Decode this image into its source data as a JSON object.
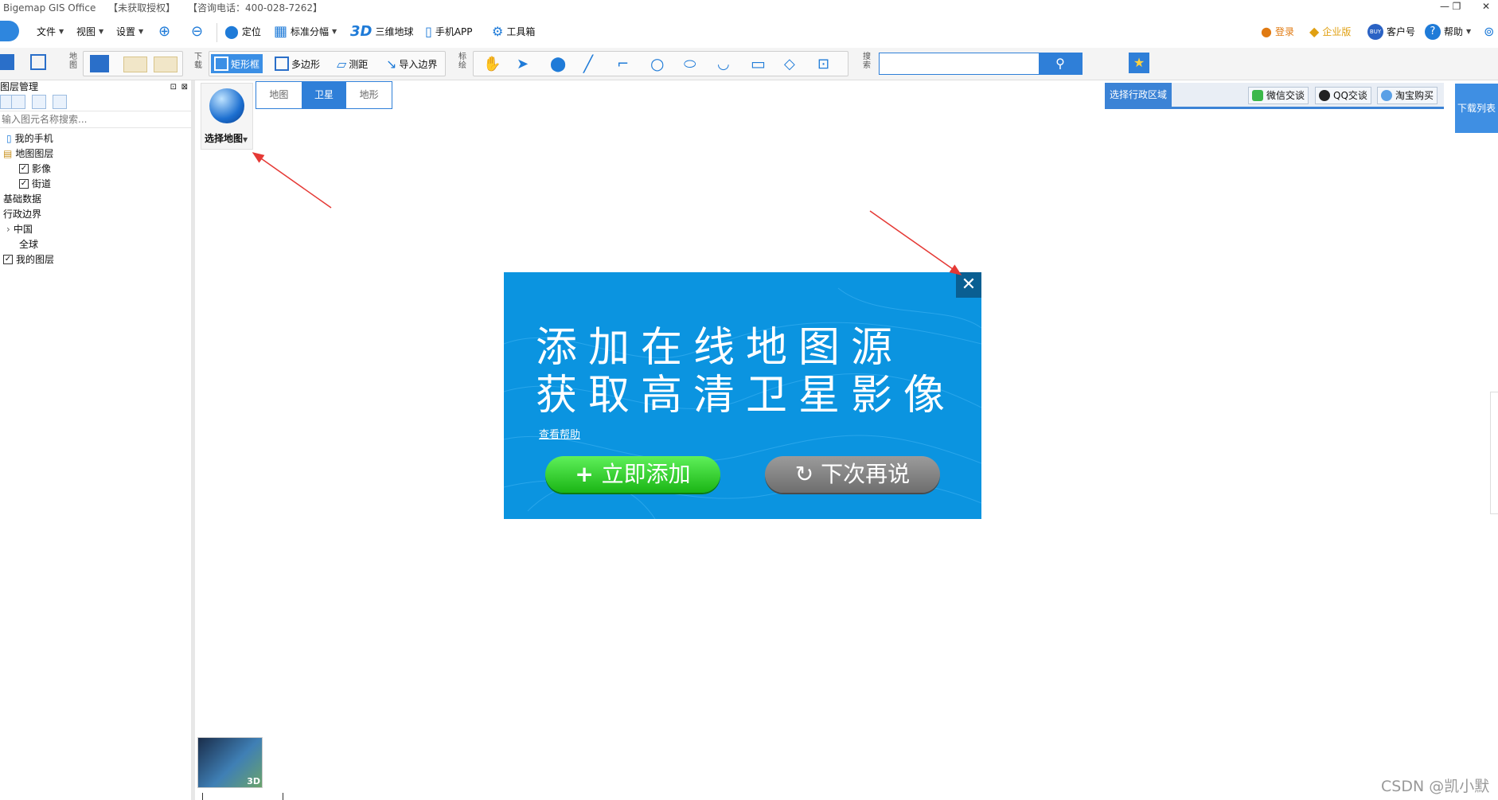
{
  "window": {
    "app_name": "Bigemap GIS Office",
    "auth_status": "【未获取授权】",
    "hotline": "【咨询电话：400-028-7262】"
  },
  "menubar": {
    "file": "文件",
    "view": "视图",
    "settings": "设置",
    "locate": "定位",
    "standard_sheet": "标准分幅",
    "three_d_label": "3D",
    "globe": "三维地球",
    "mobile_app": "手机APP",
    "toolbox": "工具箱",
    "login": "登录",
    "enterprise": "企业版",
    "customer_id": "客户号",
    "customer_badge": "BUY",
    "help": "帮助"
  },
  "toolbar": {
    "map_group_label": "地图",
    "download_group_label": "下载",
    "rect_box": "矩形框",
    "polygon": "多边形",
    "measure": "测距",
    "import_boundary": "导入边界",
    "annotate_group_label": "标绘",
    "search_group_label": "搜索",
    "search_placeholder": ""
  },
  "layer_panel": {
    "title": "图层管理",
    "search_placeholder": "输入图元名称搜索...",
    "items": [
      {
        "label": "我的手机"
      },
      {
        "label": "地图图层"
      },
      {
        "label": "影像",
        "checked": true
      },
      {
        "label": "街道",
        "checked": true
      },
      {
        "label": "基础数据"
      },
      {
        "label": "行政边界"
      },
      {
        "label": "中国"
      },
      {
        "label": "全球"
      },
      {
        "label": "我的图层",
        "checked": true
      }
    ]
  },
  "map_view": {
    "select_map": "选择地图",
    "tabs": [
      {
        "label": "地图",
        "active": false
      },
      {
        "label": "卫星",
        "active": true
      },
      {
        "label": "地形",
        "active": false
      }
    ],
    "select_region": "选择行政区域",
    "wechat": "微信交谈",
    "qq": "QQ交谈",
    "taobao": "淘宝购买",
    "download_list": "下载列表",
    "thumb_label": "3D"
  },
  "popup": {
    "line1": "添加在线地图源",
    "line2": "获取高清卫星影像",
    "help_link": "查看帮助",
    "add_now": "立即添加",
    "later": "下次再说",
    "close_symbol": "✕"
  },
  "watermark": "CSDN @凯小默",
  "colors": {
    "accent": "#2f7fd8",
    "popup_bg": "#0b94e0",
    "add_button": "#1bb515",
    "later_button": "#7a7a7a",
    "arrow": "#e53935"
  }
}
